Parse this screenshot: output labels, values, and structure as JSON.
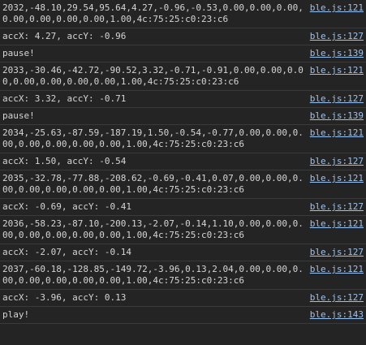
{
  "entries": [
    {
      "text": "2032,-48.10,29.54,95.64,4.27,-0.96,-0.53,0.00,0.00,0.00,0.00,0.00,0.00,0.00,1.00,4c:75:25:c0:23:c6",
      "source": "ble.js:121"
    },
    {
      "text": "accX: 4.27, accY: -0.96",
      "source": "ble.js:127"
    },
    {
      "text": "pause!",
      "source": "ble.js:139"
    },
    {
      "text": "2033,-30.46,-42.72,-90.52,3.32,-0.71,-0.91,0.00,0.00,0.00,0.00,0.00,0.00,0.00,1.00,4c:75:25:c0:23:c6",
      "source": "ble.js:121"
    },
    {
      "text": "accX: 3.32, accY: -0.71",
      "source": "ble.js:127"
    },
    {
      "text": "pause!",
      "source": "ble.js:139"
    },
    {
      "text": "2034,-25.63,-87.59,-187.19,1.50,-0.54,-0.77,0.00,0.00,0.00,0.00,0.00,0.00,0.00,1.00,4c:75:25:c0:23:c6",
      "source": "ble.js:121"
    },
    {
      "text": "accX: 1.50, accY: -0.54",
      "source": "ble.js:127"
    },
    {
      "text": "2035,-32.78,-77.88,-208.62,-0.69,-0.41,0.07,0.00,0.00,0.00,0.00,0.00,0.00,0.00,1.00,4c:75:25:c0:23:c6",
      "source": "ble.js:121"
    },
    {
      "text": "accX: -0.69, accY: -0.41",
      "source": "ble.js:127"
    },
    {
      "text": "2036,-58.23,-87.10,-200.13,-2.07,-0.14,1.10,0.00,0.00,0.00,0.00,0.00,0.00,0.00,1.00,4c:75:25:c0:23:c6",
      "source": "ble.js:121"
    },
    {
      "text": "accX: -2.07, accY: -0.14",
      "source": "ble.js:127"
    },
    {
      "text": "2037,-60.18,-128.85,-149.72,-3.96,0.13,2.04,0.00,0.00,0.00,0.00,0.00,0.00,0.00,1.00,4c:75:25:c0:23:c6",
      "source": "ble.js:121"
    },
    {
      "text": "accX: -3.96, accY: 0.13",
      "source": "ble.js:127"
    },
    {
      "text": "play!",
      "source": "ble.js:143"
    }
  ]
}
